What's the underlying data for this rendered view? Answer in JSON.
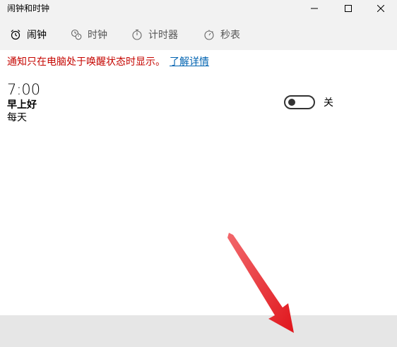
{
  "window": {
    "title": "闹钟和时钟"
  },
  "tabs": [
    {
      "label": "闹钟",
      "icon": "alarm-clock-icon",
      "active": true
    },
    {
      "label": "时钟",
      "icon": "world-clock-icon",
      "active": false
    },
    {
      "label": "计时器",
      "icon": "timer-icon",
      "active": false
    },
    {
      "label": "秒表",
      "icon": "stopwatch-icon",
      "active": false
    }
  ],
  "notice": {
    "text": "通知只在电脑处于唤醒状态时显示。",
    "link": "了解详情"
  },
  "alarm": {
    "time": "7:00",
    "name": "早上好",
    "repeat": "每天",
    "toggle_state": "关",
    "enabled": false
  },
  "colors": {
    "notice_text": "#c50500",
    "link": "#0063b1",
    "title_bg": "#f2f2f2",
    "command_bar_bg": "#e6e6e6",
    "annotation_arrow": "#e8242a"
  }
}
